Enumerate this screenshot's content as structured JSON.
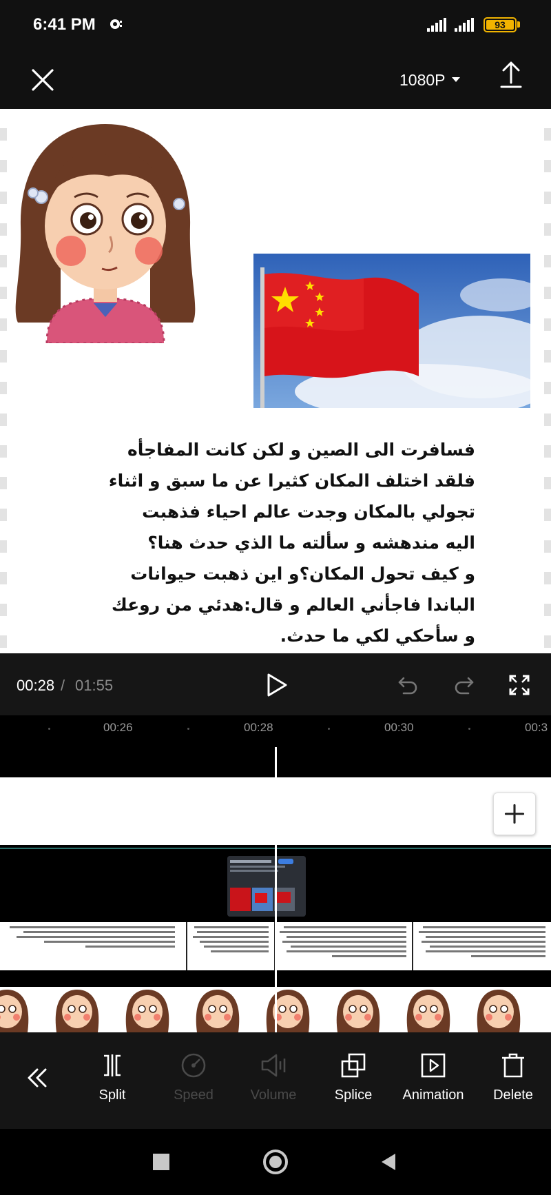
{
  "status_bar": {
    "time": "6:41 PM",
    "battery": "93"
  },
  "top_bar": {
    "resolution": "1080P"
  },
  "preview": {
    "story_text": "فسافرت الى الصين و لكن كانت المفاجأه\nفلقد اختلف المكان كثيرا عن ما سبق و اثناء\nتجولي بالمكان وجدت عالم احياء فذهبت\nاليه مندهشه و سألته ما الذي حدث هنا؟\nو كيف تحول المكان؟و اين ذهبت حيوانات\nالباندا فاجأني العالم و قال:هدئي من روعك\nو سأحكي لكي ما حدث."
  },
  "playback": {
    "current_time": "00:28",
    "separator": "/",
    "total_time": "01:55"
  },
  "timeline": {
    "ruler": [
      "00:26",
      "00:28",
      "00:30",
      "00:3"
    ]
  },
  "toolbar": {
    "tools": [
      {
        "label": "Split",
        "enabled": true
      },
      {
        "label": "Speed",
        "enabled": false
      },
      {
        "label": "Volume",
        "enabled": false
      },
      {
        "label": "Splice",
        "enabled": true
      },
      {
        "label": "Animation",
        "enabled": true
      },
      {
        "label": "Delete",
        "enabled": true
      }
    ]
  },
  "colors": {
    "battery": "#f2b400",
    "timeline_accent": "#2a6f6a",
    "toolbar_bg": "#151515"
  }
}
